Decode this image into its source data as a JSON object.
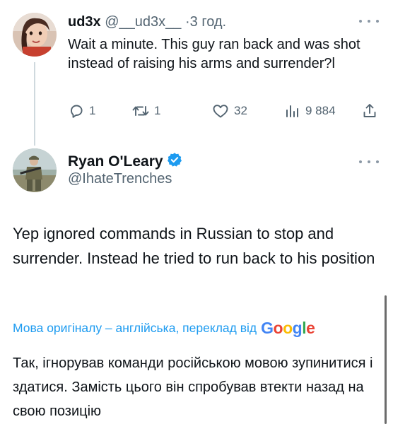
{
  "reply_tweet": {
    "display_name": "ud3x",
    "handle": "@__ud3x__",
    "separator": "·",
    "time": "3 год.",
    "text": "Wait a minute. This guy ran back and was shot instead of raising his arms and surrender?l",
    "actions": {
      "replies": "1",
      "retweets": "1",
      "likes": "32",
      "views": "9 884"
    }
  },
  "main_tweet": {
    "display_name": "Ryan O'Leary",
    "handle": "@IhateTrenches",
    "verified": true,
    "text": "Yep ignored commands in Russian to stop and surrender. Instead he tried to run back to his position",
    "translation_label": "Мова оригіналу – англійська, переклад від",
    "translation_provider": "Google",
    "translated_text": "Так, ігнорував команди російською мовою зупинитися і здатися. Замість цього він спробував втекти назад на свою позицію"
  },
  "colors": {
    "link_blue": "#1d9bf0",
    "muted_gray": "#536471",
    "text": "#0f1419"
  },
  "icons": [
    "reply-icon",
    "retweet-icon",
    "like-icon",
    "views-icon",
    "share-icon",
    "verified-badge-icon",
    "more-options-icon"
  ]
}
